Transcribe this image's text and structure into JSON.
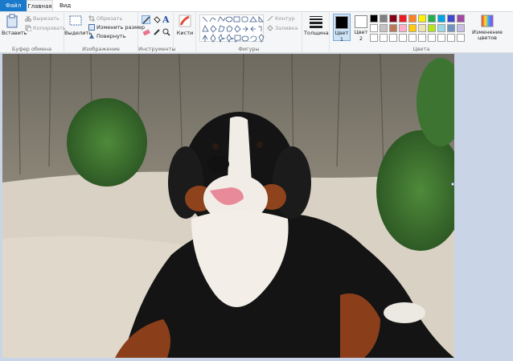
{
  "menu": {
    "file": "Файл",
    "home": "Главная",
    "view": "Вид"
  },
  "clipboard": {
    "paste": "Вставить",
    "cut": "Вырезать",
    "copy": "Копировать",
    "group": "Буфер обмена"
  },
  "image": {
    "select": "Выделить",
    "crop": "Обрезать",
    "resize": "Изменить размер",
    "rotate": "Повернуть",
    "group": "Изображение"
  },
  "tools": {
    "group": "Инструменты",
    "text_glyph": "A"
  },
  "brushes": {
    "label": "Кисти"
  },
  "shapes": {
    "outline": "Контур",
    "fill": "Заливка",
    "group": "Фигуры"
  },
  "size": {
    "label": "Толщина"
  },
  "colors": {
    "color1": "Цвет 1",
    "color2": "Цвет 2",
    "edit": "Изменение цветов",
    "group": "Цвета",
    "color1_value": "#000000",
    "color2_value": "#ffffff",
    "palette": [
      "#000000",
      "#7f7f7f",
      "#880015",
      "#ed1c24",
      "#ff7f27",
      "#fff200",
      "#22b14c",
      "#00a2e8",
      "#3f48cc",
      "#a349a4",
      "#ffffff",
      "#c3c3c3",
      "#b97a57",
      "#ffaec9",
      "#ffc90e",
      "#efe4b0",
      "#b5e61d",
      "#99d9ea",
      "#7092be",
      "#c8bfe7",
      "#ffffff",
      "#ffffff",
      "#ffffff",
      "#ffffff",
      "#ffffff",
      "#ffffff",
      "#ffffff",
      "#ffffff",
      "#ffffff",
      "#ffffff"
    ]
  }
}
